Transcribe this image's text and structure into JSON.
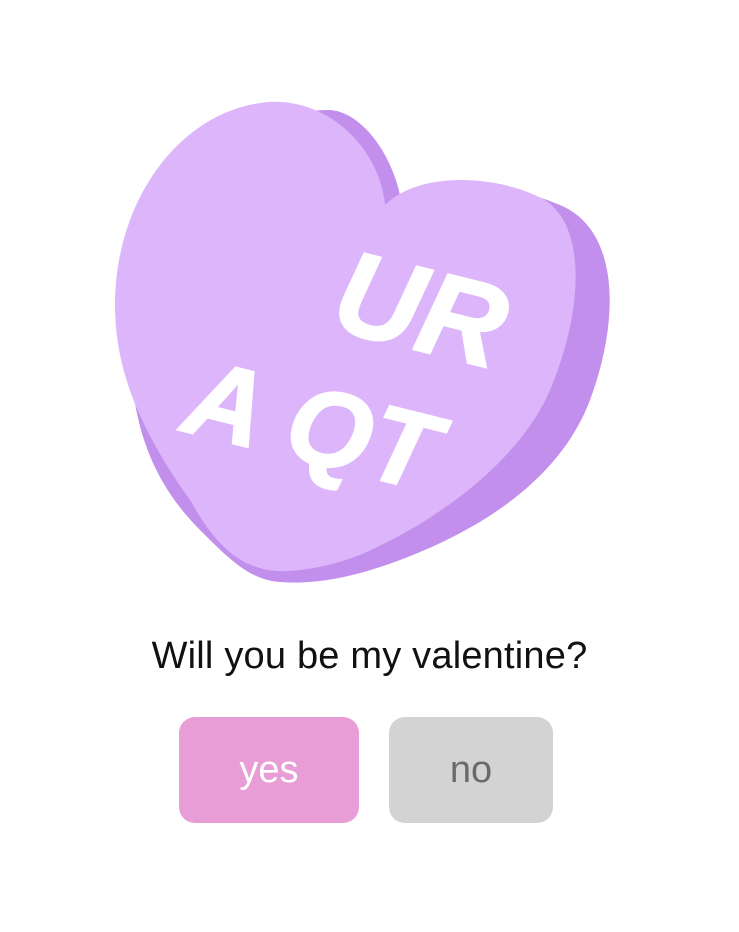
{
  "heart": {
    "line1": "UR",
    "line2": "A QT",
    "colors": {
      "face": "#ddb5fb",
      "side": "#c28fec",
      "text": "#ffffff"
    }
  },
  "prompt": {
    "question": "Will you be my valentine?"
  },
  "buttons": {
    "yes": {
      "label": "yes",
      "bg": "#e99dd6",
      "color": "#ffffff"
    },
    "no": {
      "label": "no",
      "bg": "#d3d3d3",
      "color": "#6a6a6a"
    }
  }
}
